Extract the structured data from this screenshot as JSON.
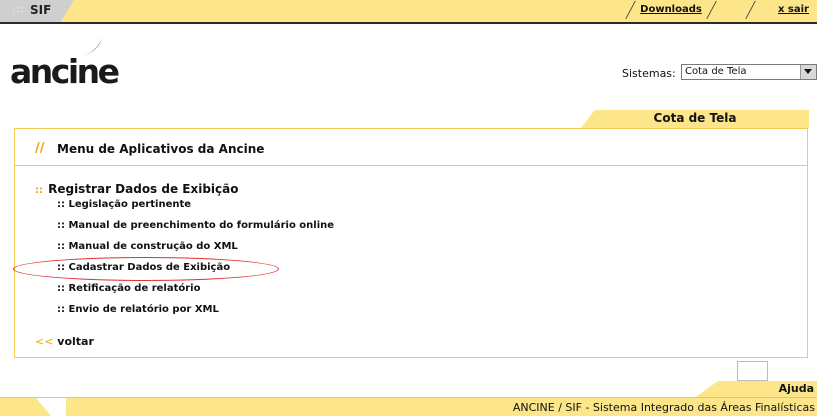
{
  "header": {
    "app_dots": ":::",
    "app_label": "SIF",
    "downloads_label": "Downloads",
    "sair_label": "x sair"
  },
  "logo": {
    "text": "ancine",
    "swoosh_color": "#76b043"
  },
  "sistemas": {
    "label": "Sistemas:",
    "selected": "Cota de Tela"
  },
  "panel": {
    "tab_label": "Cota de Tela",
    "header_prefix": "//",
    "header_title": "Menu de Aplicativos da Ancine",
    "section_prefix": "::",
    "section_title": "Registrar Dados de Exibição",
    "item_prefix": "::",
    "items": [
      {
        "label": "Legislação pertinente"
      },
      {
        "label": "Manual de preenchimento do formulário online"
      },
      {
        "label": "Manual de construção do XML"
      },
      {
        "label": "Cadastrar Dados de Exibição"
      },
      {
        "label": "Retificação de relatório"
      },
      {
        "label": "Envio de relatório por XML"
      }
    ],
    "back_arrows": "<<",
    "back_label": "voltar"
  },
  "footer": {
    "ajuda_label": "Ajuda",
    "dots": ":::",
    "text": "ANCINE / SIF - Sistema Integrado das Áreas Finalísticas"
  },
  "colors": {
    "accent_yellow": "#fde58a",
    "accent_orange": "#eba800",
    "border_yellow": "#f2cc55",
    "annotation_red": "#e03030"
  }
}
